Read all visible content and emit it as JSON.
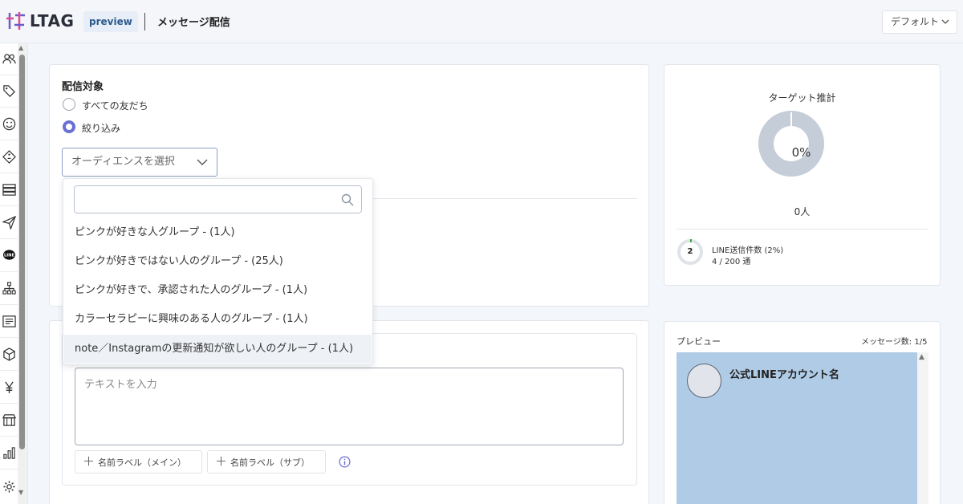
{
  "header": {
    "logo_text": "LTAG",
    "badge": "preview",
    "page_title": "メッセージ配信",
    "workspace_select": "デフォルト",
    "logo_colors": [
      "#e04b8a",
      "#6a5acd"
    ]
  },
  "sidebar": {
    "icons": [
      "friends-icon",
      "tag-icon",
      "smile-icon",
      "coupon-icon",
      "list-icon",
      "send-icon",
      "line-icon",
      "hierarchy-icon",
      "document-icon",
      "box-icon",
      "yen-icon",
      "store-icon",
      "chart-icon",
      "settings-icon"
    ]
  },
  "delivery": {
    "title": "配信対象",
    "option_all": "すべての友だち",
    "option_filter": "絞り込み",
    "selected_option": "絞り込み",
    "audience_placeholder": "オーディエンスを選択",
    "search_placeholder": "",
    "groups": [
      "ピンクが好きな人グループ - (1人)",
      "ピンクが好きではない人のグループ - (25人)",
      "ピンクが好きで、承認された人のグループ - (1人)",
      "カラーセラピーに興味のある人のグループ - (1人)",
      "note／Instagramの更新通知が欲しい人のグループ - (1人)"
    ],
    "highlighted_group_index": 4
  },
  "message": {
    "text_placeholder": "テキストを入力",
    "label_main": "名前ラベル（メイン）",
    "label_sub": "名前ラベル（サブ）"
  },
  "target": {
    "title": "ターゲット推計",
    "percent": "0%",
    "count": "0人",
    "line_sent_label": "LINE送信件数 (2%)",
    "line_sent_value": "4 / 200 通",
    "line_sent_number": "2",
    "line_sent_ratio": 0.02,
    "accent_color": "#2ca02c",
    "donut_color": "#c5cdd8"
  },
  "preview": {
    "title": "プレビュー",
    "message_count": "メッセージ数: 1/5",
    "account_name": "公式LINEアカウント名",
    "background_color": "#b0cbe6"
  }
}
